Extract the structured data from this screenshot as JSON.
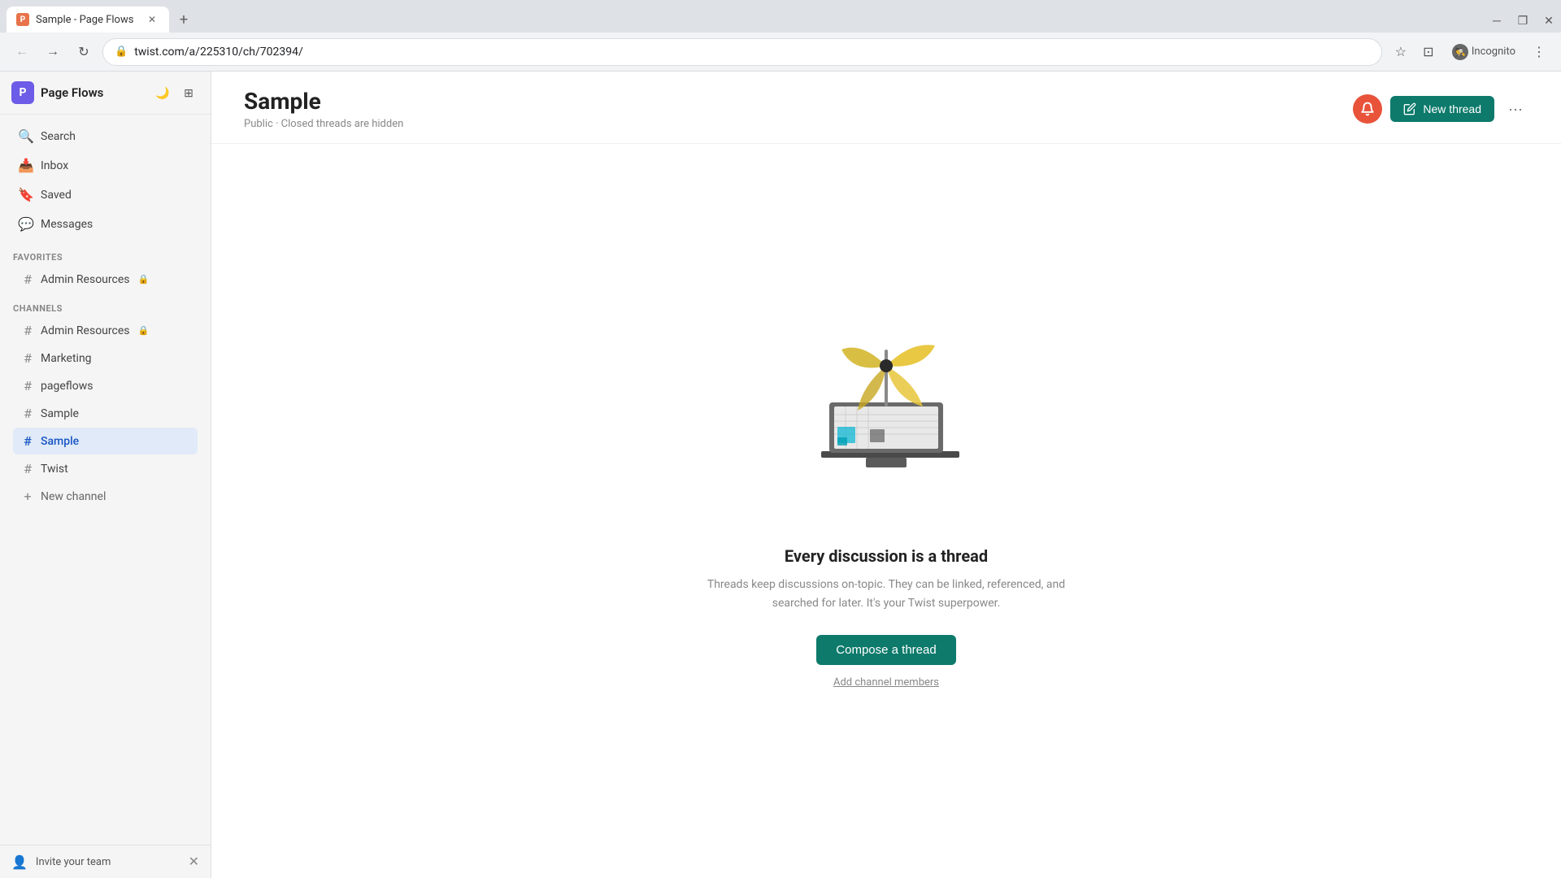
{
  "browser": {
    "tab_title": "Sample - Page Flows",
    "tab_favicon": "P",
    "url": "twist.com/a/225310/ch/702394/",
    "incognito_label": "Incognito"
  },
  "sidebar": {
    "workspace_initial": "P",
    "workspace_name": "Page Flows",
    "nav_items": [
      {
        "id": "search",
        "icon": "🔍",
        "label": "Search"
      },
      {
        "id": "inbox",
        "icon": "📥",
        "label": "Inbox"
      },
      {
        "id": "saved",
        "icon": "🔖",
        "label": "Saved"
      },
      {
        "id": "messages",
        "icon": "💬",
        "label": "Messages"
      }
    ],
    "favorites_title": "Favorites",
    "favorites_items": [
      {
        "id": "admin-resources-fav",
        "label": "Admin Resources",
        "locked": true
      }
    ],
    "channels_title": "Channels",
    "channels": [
      {
        "id": "admin-resources",
        "label": "Admin Resources",
        "locked": true,
        "active": false
      },
      {
        "id": "marketing",
        "label": "Marketing",
        "locked": false,
        "active": false
      },
      {
        "id": "pageflows",
        "label": "pageflows",
        "locked": false,
        "active": false
      },
      {
        "id": "sample-1",
        "label": "Sample",
        "locked": false,
        "active": false
      },
      {
        "id": "sample-2",
        "label": "Sample",
        "locked": false,
        "active": true
      },
      {
        "id": "twist",
        "label": "Twist",
        "locked": false,
        "active": false
      }
    ],
    "new_channel_label": "New channel",
    "invite_team_label": "Invite your team"
  },
  "channel": {
    "title": "Sample",
    "subtitle": "Public · Closed threads are hidden",
    "new_thread_label": "New thread",
    "empty_title": "Every discussion is a thread",
    "empty_description": "Threads keep discussions on-topic. They can be linked, referenced, and searched for later. It's your Twist superpower.",
    "compose_thread_label": "Compose a thread",
    "add_members_label": "Add channel members"
  },
  "icons": {
    "moon": "🌙",
    "grid": "⊞",
    "back": "←",
    "forward": "→",
    "refresh": "↻",
    "star": "☆",
    "profile": "👤",
    "more_vert": "⋮",
    "hash": "#",
    "plus": "+",
    "bell": "🔔",
    "new_thread_icon": "✏️",
    "ellipsis": "···",
    "user_plus": "👤"
  }
}
